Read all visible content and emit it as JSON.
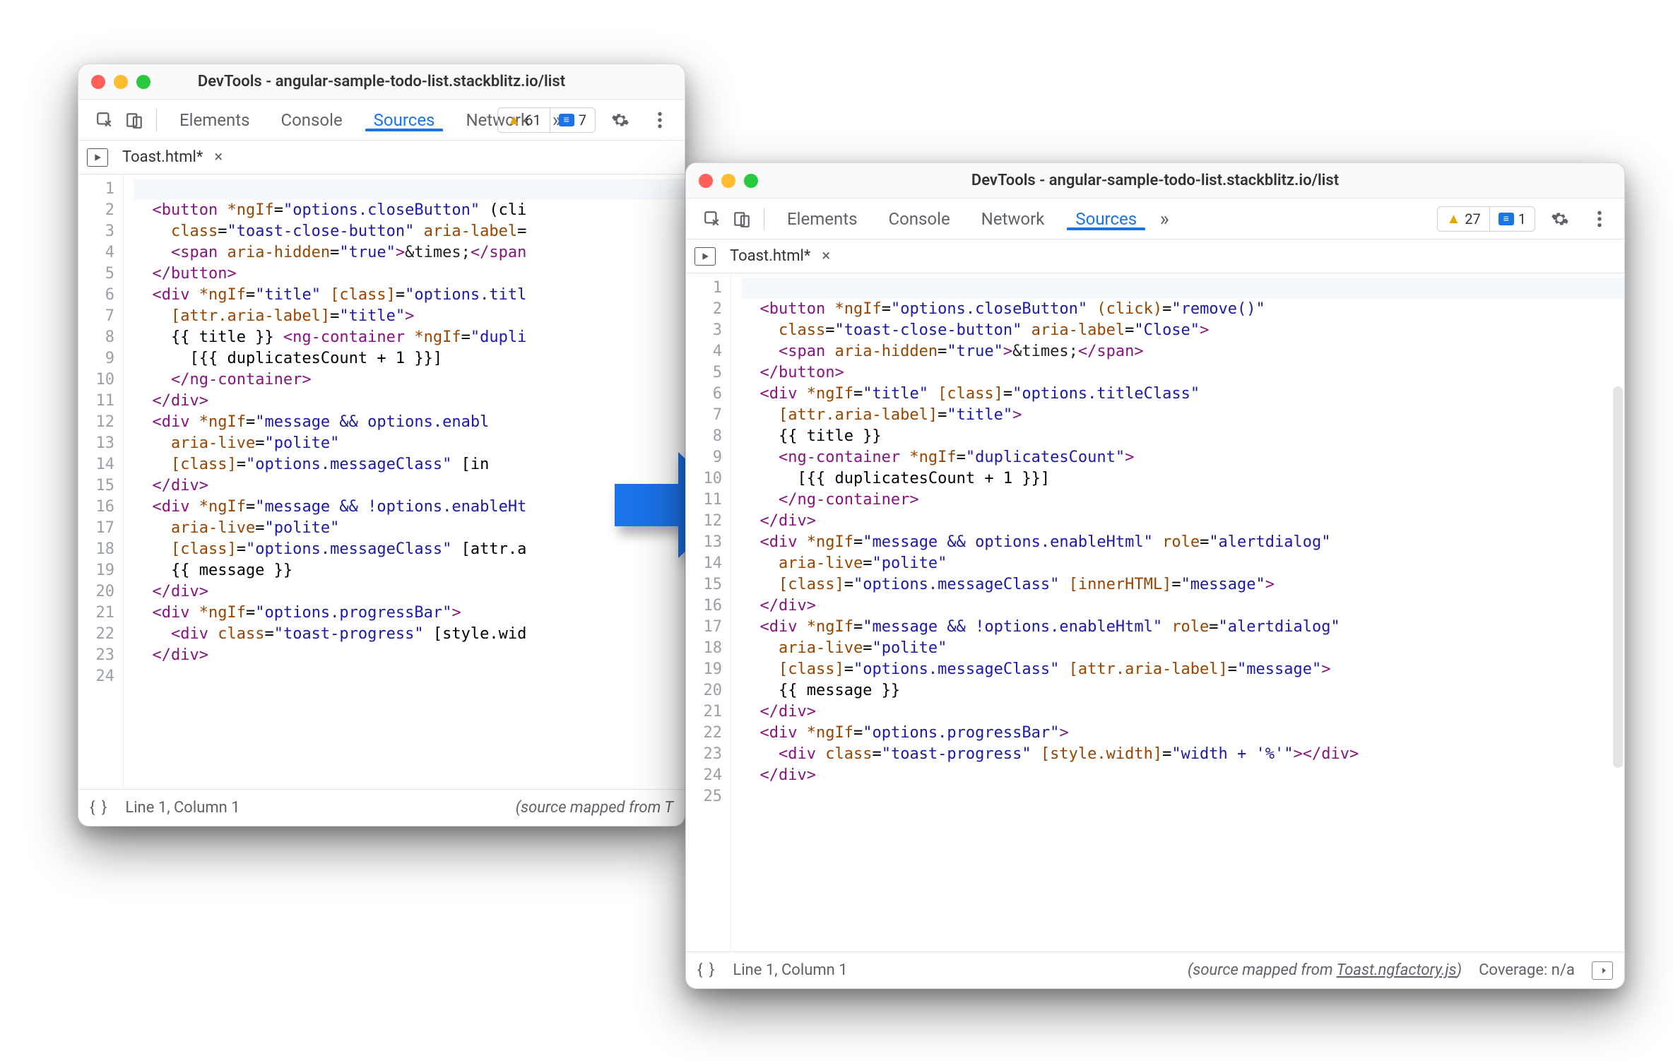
{
  "windowA": {
    "title": "DevTools - angular-sample-todo-list.stackblitz.io/list",
    "tabs": [
      "Elements",
      "Console",
      "Sources",
      "Network"
    ],
    "activeTab": "Sources",
    "moreGlyph": "»",
    "warnCount": "61",
    "infoCount": "7",
    "fileTab": "Toast.html*",
    "status": {
      "pos": "Line 1, Column 1",
      "mapped": "(source mapped from T"
    },
    "lines": [
      "",
      "  <button *ngIf=\"options.closeButton\" (cli",
      "    class=\"toast-close-button\" aria-label=",
      "    <span aria-hidden=\"true\">&times;</span",
      "  </button>",
      "  <div *ngIf=\"title\" [class]=\"options.titl",
      "    [attr.aria-label]=\"title\">",
      "    {{ title }} <ng-container *ngIf=\"dupli",
      "      [{{ duplicatesCount + 1 }}]",
      "    </ng-container>",
      "  </div>",
      "  <div *ngIf=\"message && options.enabl",
      "    aria-live=\"polite\"",
      "    [class]=\"options.messageClass\" [in",
      "  </div>",
      "  <div *ngIf=\"message && !options.enableHt",
      "    aria-live=\"polite\"",
      "    [class]=\"options.messageClass\" [attr.a",
      "    {{ message }}",
      "  </div>",
      "  <div *ngIf=\"options.progressBar\">",
      "    <div class=\"toast-progress\" [style.wid",
      "  </div>",
      ""
    ]
  },
  "windowB": {
    "title": "DevTools - angular-sample-todo-list.stackblitz.io/list",
    "tabs": [
      "Elements",
      "Console",
      "Network",
      "Sources"
    ],
    "activeTab": "Sources",
    "moreGlyph": "»",
    "warnCount": "27",
    "infoCount": "1",
    "fileTab": "Toast.html*",
    "status": {
      "pos": "Line 1, Column 1",
      "mappedPrefix": "(source mapped from ",
      "mappedLink": "Toast.ngfactory.js",
      "mappedSuffix": ")",
      "coverage": "Coverage: n/a"
    },
    "lines": [
      "",
      "  <button *ngIf=\"options.closeButton\" (click)=\"remove()\"",
      "    class=\"toast-close-button\" aria-label=\"Close\">",
      "    <span aria-hidden=\"true\">&times;</span>",
      "  </button>",
      "  <div *ngIf=\"title\" [class]=\"options.titleClass\"",
      "    [attr.aria-label]=\"title\">",
      "    {{ title }}",
      "    <ng-container *ngIf=\"duplicatesCount\">",
      "      [{{ duplicatesCount + 1 }}]",
      "    </ng-container>",
      "  </div>",
      "  <div *ngIf=\"message && options.enableHtml\" role=\"alertdialog\"",
      "    aria-live=\"polite\"",
      "    [class]=\"options.messageClass\" [innerHTML]=\"message\">",
      "  </div>",
      "  <div *ngIf=\"message && !options.enableHtml\" role=\"alertdialog\"",
      "    aria-live=\"polite\"",
      "    [class]=\"options.messageClass\" [attr.aria-label]=\"message\">",
      "    {{ message }}",
      "  </div>",
      "  <div *ngIf=\"options.progressBar\">",
      "    <div class=\"toast-progress\" [style.width]=\"width + '%'\"></div>",
      "  </div>",
      ""
    ]
  }
}
